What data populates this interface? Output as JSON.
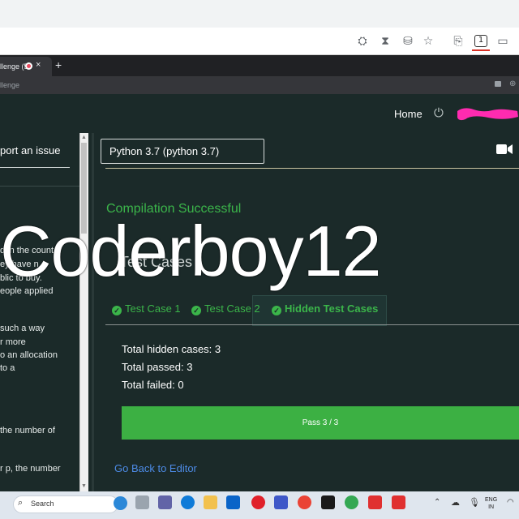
{
  "browser": {
    "icons": [
      "incognito-icon",
      "hourglass-icon",
      "database-icon",
      "star-icon",
      "puzzle-icon",
      "extension-badge-icon",
      "cast-icon"
    ],
    "extension_badge": "1"
  },
  "inner_browser": {
    "tab_title": "llenge (5",
    "new_tab": "+",
    "close": "×",
    "url_fragment": "llenge"
  },
  "header": {
    "home": "Home",
    "power_icon": "power-icon"
  },
  "problem_panel": {
    "report_issue": "port an issue",
    "lines": [
      "d in the count",
      "ey have n",
      "blic to buy.",
      "eople applied",
      "such a way",
      "r more",
      "o an allocation",
      "to a",
      "the number of",
      "r p, the number"
    ]
  },
  "editor": {
    "language": "Python 3.7 (python 3.7)"
  },
  "results": {
    "compile_status": "Compilation Successful",
    "title": "Test Cases",
    "tabs": [
      "Test Case 1",
      "Test Case 2",
      "Hidden Test Cases"
    ],
    "hidden_total": "Total hidden cases: 3",
    "passed": "Total passed: 3",
    "failed": "Total failed: 0",
    "pass_bar": "Pass 3 / 3",
    "pass_fraction": 1.0,
    "back": "Go Back to Editor"
  },
  "watermark": "Coderboy12",
  "taskbar": {
    "search": "Search",
    "lang": "ENG",
    "region": "IN"
  },
  "colors": {
    "page_bg": "#1b2a29",
    "success": "#3bb54a",
    "link": "#4d8be6",
    "pass_bar": "#3cb043"
  }
}
